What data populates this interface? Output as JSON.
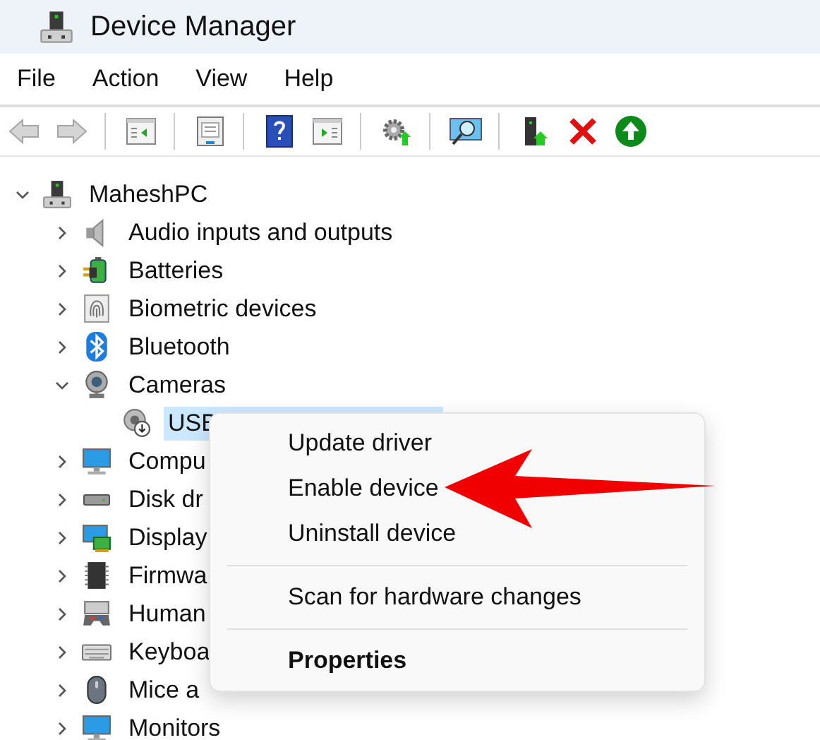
{
  "window": {
    "title": "Device Manager"
  },
  "menu_bar": [
    {
      "label": "File"
    },
    {
      "label": "Action"
    },
    {
      "label": "View"
    },
    {
      "label": "Help"
    }
  ],
  "toolbar": [
    [
      {
        "kind": "back",
        "disabled": true
      },
      {
        "kind": "forward",
        "disabled": true
      }
    ],
    [
      {
        "kind": "console-tree",
        "disabled": false
      }
    ],
    [
      {
        "kind": "properties",
        "disabled": false
      }
    ],
    [
      {
        "kind": "help",
        "disabled": false
      },
      {
        "kind": "action-pane",
        "disabled": false
      }
    ],
    [
      {
        "kind": "update-driver",
        "disabled": false
      }
    ],
    [
      {
        "kind": "scan",
        "disabled": false
      }
    ],
    [
      {
        "kind": "add-legacy",
        "disabled": false
      },
      {
        "kind": "uninstall",
        "disabled": false
      },
      {
        "kind": "enable",
        "disabled": false
      }
    ]
  ],
  "tree": [
    {
      "label": "MaheshPC",
      "kind": "computer",
      "expanded": true,
      "selected": false,
      "children": [
        {
          "label": "Audio inputs and outputs",
          "kind": "audio",
          "expanded": false,
          "selected": false
        },
        {
          "label": "Batteries",
          "kind": "battery",
          "expanded": false,
          "selected": false
        },
        {
          "label": "Biometric devices",
          "kind": "biometric",
          "expanded": false,
          "selected": false
        },
        {
          "label": "Bluetooth",
          "kind": "bluetooth",
          "expanded": false,
          "selected": false
        },
        {
          "label": "Cameras",
          "kind": "camera",
          "expanded": true,
          "selected": false,
          "children": [
            {
              "label": "USB",
              "kind": "camera-device",
              "selected": true
            }
          ]
        },
        {
          "label": "Compu",
          "kind": "monitor",
          "expanded": false,
          "selected": false
        },
        {
          "label": "Disk dr",
          "kind": "disk",
          "expanded": false,
          "selected": false
        },
        {
          "label": "Display",
          "kind": "display-adapter",
          "expanded": false,
          "selected": false
        },
        {
          "label": "Firmwa",
          "kind": "chip",
          "expanded": false,
          "selected": false
        },
        {
          "label": "Human",
          "kind": "hid",
          "expanded": false,
          "selected": false
        },
        {
          "label": "Keyboa",
          "kind": "keyboard",
          "expanded": false,
          "selected": false
        },
        {
          "label": "Mice a",
          "kind": "mouse",
          "expanded": false,
          "selected": false
        },
        {
          "label": "Monitors",
          "kind": "monitor",
          "expanded": false,
          "selected": false
        }
      ]
    }
  ],
  "context_menu": {
    "items": [
      {
        "kind": "item",
        "label": "Update driver",
        "pointed_at": false
      },
      {
        "kind": "item",
        "label": "Enable device",
        "pointed_at": true
      },
      {
        "kind": "item",
        "label": "Uninstall device",
        "pointed_at": false
      },
      {
        "kind": "separator"
      },
      {
        "kind": "item",
        "label": "Scan for hardware changes",
        "pointed_at": false
      },
      {
        "kind": "separator"
      },
      {
        "kind": "default",
        "label": "Properties",
        "pointed_at": false
      }
    ]
  }
}
